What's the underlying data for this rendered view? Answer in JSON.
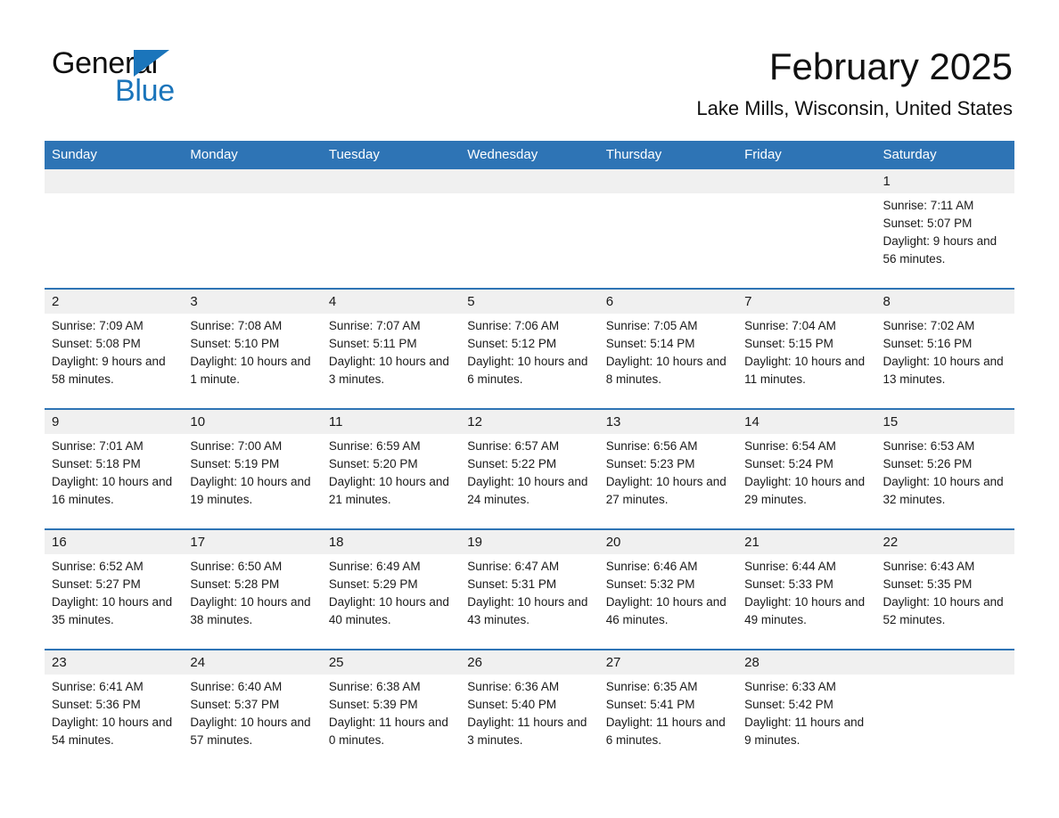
{
  "logo": {
    "text_primary": "General",
    "text_secondary": "Blue",
    "triangle_color": "#1b75bb"
  },
  "header": {
    "title": "February 2025",
    "subtitle": "Lake Mills, Wisconsin, United States"
  },
  "colors": {
    "header_blue": "#2e74b5",
    "daynum_band": "#f0f0f0",
    "text": "#1a1a1a"
  },
  "weekday_headers": [
    "Sunday",
    "Monday",
    "Tuesday",
    "Wednesday",
    "Thursday",
    "Friday",
    "Saturday"
  ],
  "weeks": [
    [
      {
        "day": "",
        "sunrise": "",
        "sunset": "",
        "daylight": ""
      },
      {
        "day": "",
        "sunrise": "",
        "sunset": "",
        "daylight": ""
      },
      {
        "day": "",
        "sunrise": "",
        "sunset": "",
        "daylight": ""
      },
      {
        "day": "",
        "sunrise": "",
        "sunset": "",
        "daylight": ""
      },
      {
        "day": "",
        "sunrise": "",
        "sunset": "",
        "daylight": ""
      },
      {
        "day": "",
        "sunrise": "",
        "sunset": "",
        "daylight": ""
      },
      {
        "day": "1",
        "sunrise": "Sunrise: 7:11 AM",
        "sunset": "Sunset: 5:07 PM",
        "daylight": "Daylight: 9 hours and 56 minutes."
      }
    ],
    [
      {
        "day": "2",
        "sunrise": "Sunrise: 7:09 AM",
        "sunset": "Sunset: 5:08 PM",
        "daylight": "Daylight: 9 hours and 58 minutes."
      },
      {
        "day": "3",
        "sunrise": "Sunrise: 7:08 AM",
        "sunset": "Sunset: 5:10 PM",
        "daylight": "Daylight: 10 hours and 1 minute."
      },
      {
        "day": "4",
        "sunrise": "Sunrise: 7:07 AM",
        "sunset": "Sunset: 5:11 PM",
        "daylight": "Daylight: 10 hours and 3 minutes."
      },
      {
        "day": "5",
        "sunrise": "Sunrise: 7:06 AM",
        "sunset": "Sunset: 5:12 PM",
        "daylight": "Daylight: 10 hours and 6 minutes."
      },
      {
        "day": "6",
        "sunrise": "Sunrise: 7:05 AM",
        "sunset": "Sunset: 5:14 PM",
        "daylight": "Daylight: 10 hours and 8 minutes."
      },
      {
        "day": "7",
        "sunrise": "Sunrise: 7:04 AM",
        "sunset": "Sunset: 5:15 PM",
        "daylight": "Daylight: 10 hours and 11 minutes."
      },
      {
        "day": "8",
        "sunrise": "Sunrise: 7:02 AM",
        "sunset": "Sunset: 5:16 PM",
        "daylight": "Daylight: 10 hours and 13 minutes."
      }
    ],
    [
      {
        "day": "9",
        "sunrise": "Sunrise: 7:01 AM",
        "sunset": "Sunset: 5:18 PM",
        "daylight": "Daylight: 10 hours and 16 minutes."
      },
      {
        "day": "10",
        "sunrise": "Sunrise: 7:00 AM",
        "sunset": "Sunset: 5:19 PM",
        "daylight": "Daylight: 10 hours and 19 minutes."
      },
      {
        "day": "11",
        "sunrise": "Sunrise: 6:59 AM",
        "sunset": "Sunset: 5:20 PM",
        "daylight": "Daylight: 10 hours and 21 minutes."
      },
      {
        "day": "12",
        "sunrise": "Sunrise: 6:57 AM",
        "sunset": "Sunset: 5:22 PM",
        "daylight": "Daylight: 10 hours and 24 minutes."
      },
      {
        "day": "13",
        "sunrise": "Sunrise: 6:56 AM",
        "sunset": "Sunset: 5:23 PM",
        "daylight": "Daylight: 10 hours and 27 minutes."
      },
      {
        "day": "14",
        "sunrise": "Sunrise: 6:54 AM",
        "sunset": "Sunset: 5:24 PM",
        "daylight": "Daylight: 10 hours and 29 minutes."
      },
      {
        "day": "15",
        "sunrise": "Sunrise: 6:53 AM",
        "sunset": "Sunset: 5:26 PM",
        "daylight": "Daylight: 10 hours and 32 minutes."
      }
    ],
    [
      {
        "day": "16",
        "sunrise": "Sunrise: 6:52 AM",
        "sunset": "Sunset: 5:27 PM",
        "daylight": "Daylight: 10 hours and 35 minutes."
      },
      {
        "day": "17",
        "sunrise": "Sunrise: 6:50 AM",
        "sunset": "Sunset: 5:28 PM",
        "daylight": "Daylight: 10 hours and 38 minutes."
      },
      {
        "day": "18",
        "sunrise": "Sunrise: 6:49 AM",
        "sunset": "Sunset: 5:29 PM",
        "daylight": "Daylight: 10 hours and 40 minutes."
      },
      {
        "day": "19",
        "sunrise": "Sunrise: 6:47 AM",
        "sunset": "Sunset: 5:31 PM",
        "daylight": "Daylight: 10 hours and 43 minutes."
      },
      {
        "day": "20",
        "sunrise": "Sunrise: 6:46 AM",
        "sunset": "Sunset: 5:32 PM",
        "daylight": "Daylight: 10 hours and 46 minutes."
      },
      {
        "day": "21",
        "sunrise": "Sunrise: 6:44 AM",
        "sunset": "Sunset: 5:33 PM",
        "daylight": "Daylight: 10 hours and 49 minutes."
      },
      {
        "day": "22",
        "sunrise": "Sunrise: 6:43 AM",
        "sunset": "Sunset: 5:35 PM",
        "daylight": "Daylight: 10 hours and 52 minutes."
      }
    ],
    [
      {
        "day": "23",
        "sunrise": "Sunrise: 6:41 AM",
        "sunset": "Sunset: 5:36 PM",
        "daylight": "Daylight: 10 hours and 54 minutes."
      },
      {
        "day": "24",
        "sunrise": "Sunrise: 6:40 AM",
        "sunset": "Sunset: 5:37 PM",
        "daylight": "Daylight: 10 hours and 57 minutes."
      },
      {
        "day": "25",
        "sunrise": "Sunrise: 6:38 AM",
        "sunset": "Sunset: 5:39 PM",
        "daylight": "Daylight: 11 hours and 0 minutes."
      },
      {
        "day": "26",
        "sunrise": "Sunrise: 6:36 AM",
        "sunset": "Sunset: 5:40 PM",
        "daylight": "Daylight: 11 hours and 3 minutes."
      },
      {
        "day": "27",
        "sunrise": "Sunrise: 6:35 AM",
        "sunset": "Sunset: 5:41 PM",
        "daylight": "Daylight: 11 hours and 6 minutes."
      },
      {
        "day": "28",
        "sunrise": "Sunrise: 6:33 AM",
        "sunset": "Sunset: 5:42 PM",
        "daylight": "Daylight: 11 hours and 9 minutes."
      },
      {
        "day": "",
        "sunrise": "",
        "sunset": "",
        "daylight": ""
      }
    ]
  ]
}
